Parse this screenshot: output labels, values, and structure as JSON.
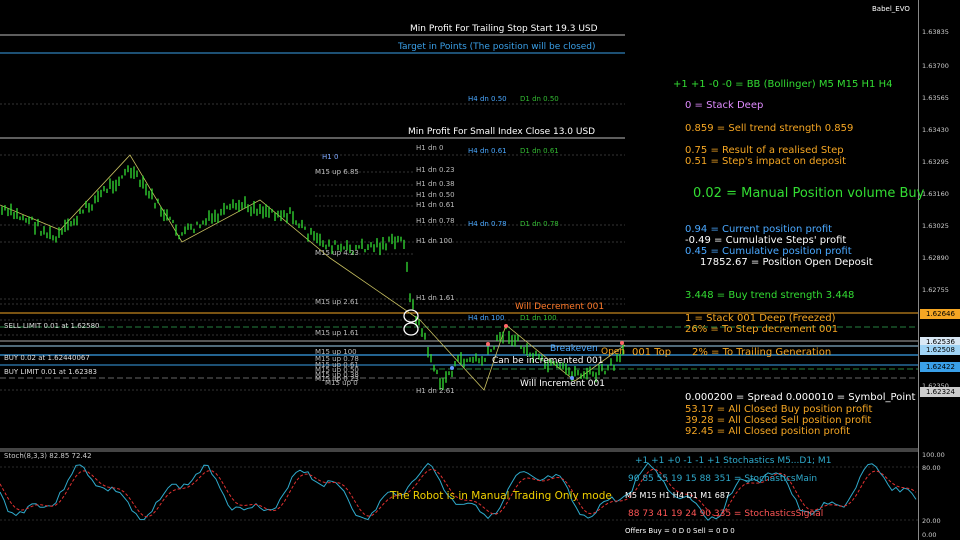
{
  "window": {
    "account_label": "Babel_EVO"
  },
  "stochastic": {
    "title": "Stoch(8,3,3) 82.85 72.42"
  },
  "price_axis": [
    "1.63835",
    "1.63700",
    "1.63565",
    "1.63430",
    "1.63295",
    "1.63160",
    "1.63025",
    "1.62890",
    "1.62755",
    "1.62350"
  ],
  "price_badges": [
    {
      "label": "1.62646",
      "color": "#f5a623"
    },
    {
      "label": "1.62536",
      "color": "#d9e8f5"
    },
    {
      "label": "1.62508",
      "color": "#9fd3f5"
    },
    {
      "label": "1.62422",
      "color": "#3aa0e8"
    },
    {
      "label": "1.62324",
      "color": "#cccccc"
    }
  ],
  "stoch_axis": [
    "100.00",
    "80.00",
    "20.00",
    "0.00"
  ],
  "lines": {
    "min_profit_trailing": "Min Profit For Trailing Stop Start 19.3 USD",
    "target": "Target in    Points (The position will be closed)",
    "min_profit_index": "Min Profit For Small Index Close  13.0 USD"
  },
  "level_labels": [
    "H4 dn 0.50",
    "D1 dn 0.50",
    "H4 dn 0.61",
    "D1 dn 0.61",
    "H1 0",
    "H1 dn 0",
    "M15 up 6.85",
    "H1 dn 0.23",
    "H1 dn 0.38",
    "H1 dn 0.50",
    "H1 dn 0.61",
    "H1 dn 0.78",
    "H4 dn 0.78",
    "D1 dn 0.78",
    "H1 dn 100",
    "M15 up 4.23",
    "M15 up 2.61",
    "H1 dn 1.61",
    "H4 dn 100",
    "D1 dn 100",
    "M15 up 1.61",
    "M15 up 100",
    "M15 up 0.78",
    "M15 up 0.61",
    "M15 up 0.50",
    "M15 up 0.38",
    "M15 up 0.23",
    "M15 up 0",
    "H1 dn 2.61"
  ],
  "orders": {
    "sell_limit": "SELL LIMIT 0.01 at 1.62580",
    "buy": "BUY 0.02 at 1.62440067",
    "buy_limit": "BUY LIMIT 0.01 at 1.62383"
  },
  "chart_marks": {
    "will_decrement": "Will Decrement 001",
    "breakeven": "Breakeven",
    "top_label": "001 Top",
    "open": "Open",
    "can_be_incremented": "Can be incremented 001",
    "will_increment": "Will Increment 001"
  },
  "panel": {
    "bb": "+1 +1 -0 -0 = BB (Bollinger) M5 M15 H1 H4",
    "stack_deep": "0  =  Stack Deep",
    "sell_strength": "0.859 = Sell trend strength 0.859",
    "result_step": "0.75 = Result of a realised Step",
    "step_impact": "0.51 = Step's impact on deposit",
    "manual_volume": "0.02 = Manual Position volume Buy",
    "current_profit": "0.94 = Current position profit",
    "cum_steps": "-0.49 = Cumulative Steps' profit",
    "cum_position": "0.45 = Cumulative position profit",
    "open_deposit": "17852.67 = Position Open Deposit",
    "buy_strength": "3.448 = Buy trend strength 3.448",
    "stack_001": "1 =  Stack 001 Deep (Freezed)",
    "step_decrement": "26% =  To Step decrement 001",
    "trailing_gen": "2% =  To Trailing Generation",
    "spread": "0.000200 = Spread    0.000010 = Symbol_Point",
    "closed_buy": "53.17 =  All Closed Buy position profit",
    "closed_sell": "39.28 =  All Closed Sell position profit",
    "closed_all": "92.45 =  All Closed position profit"
  },
  "stoch_panel": {
    "signals": "+1   +1   +0   -1   -1   +1    Stochastics M5...D1; M1",
    "main": "90   85   55   19   15   88   351 = StochasticsMain",
    "timeframes": "M5  M15 H1   H4   D1   M1   687",
    "signal": "88   73   41   19   24   90   335 = StochasticsSignal",
    "robot_mode": "The Robot is in Manual Trading Only mode",
    "offers": "Offers Buy = 0 D 0   Sell = 0 D 0"
  },
  "colors": {
    "green": "#33dd33",
    "orange": "#f5a623",
    "blue": "#4aa8ff",
    "white": "#ffffff",
    "yellow": "#f0d000",
    "red": "#ff5555",
    "violet": "#e08cff"
  }
}
